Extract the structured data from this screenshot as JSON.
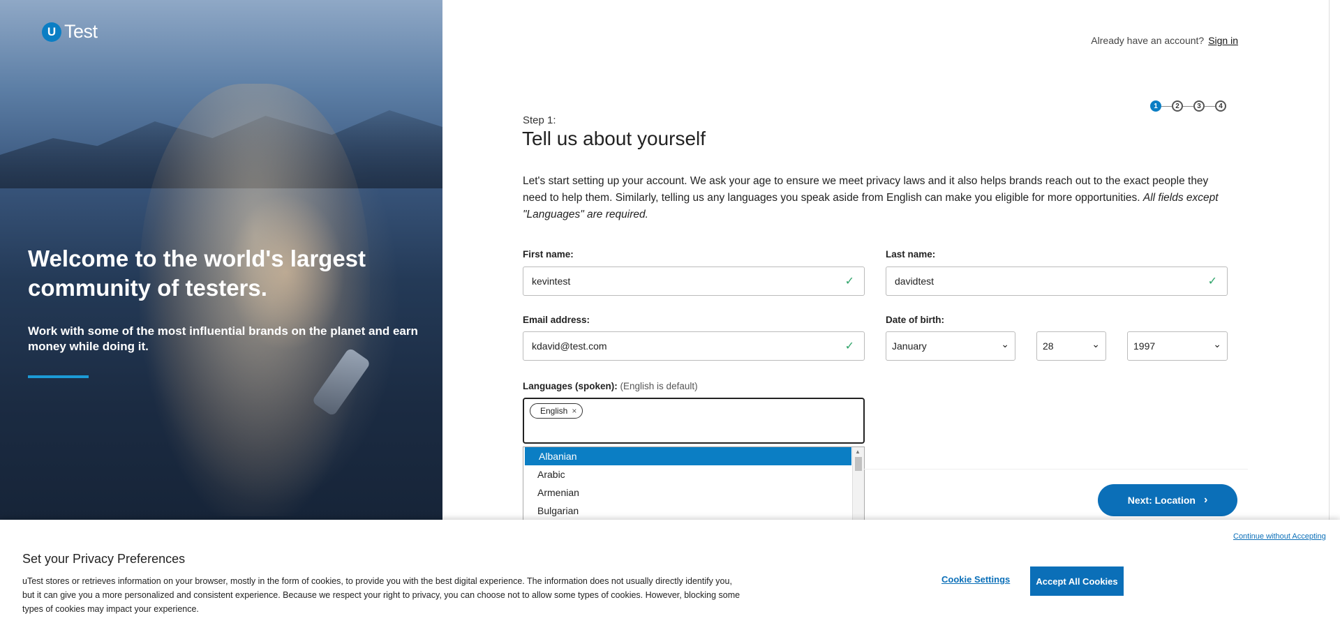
{
  "brand": {
    "logo_mark": "U",
    "logo_text": "Test",
    "accent": "#0b7ec4",
    "accent_dark": "#0b6fb8",
    "valid_color": "#2fa46a"
  },
  "hero": {
    "title": "Welcome to the world's largest community of testers.",
    "subtitle": "Work with some of the most influential brands on the planet and earn money while doing it."
  },
  "header": {
    "account_prompt": "Already have an account?",
    "signin_label": "Sign in"
  },
  "stepper": {
    "steps": [
      "1",
      "2",
      "3",
      "4"
    ],
    "current": 1
  },
  "form": {
    "step_label": "Step 1:",
    "title": "Tell us about yourself",
    "intro_text": "Let's start setting up your account. We ask your age to ensure we meet privacy laws and it also helps brands reach out to the exact people they need to help them. Similarly, telling us any languages you speak aside from English can make you eligible for more opportunities.",
    "intro_italic": "All fields except \"Languages\" are required.",
    "first_name": {
      "label": "First name:",
      "value": "kevintest"
    },
    "last_name": {
      "label": "Last name:",
      "value": "davidtest"
    },
    "email": {
      "label": "Email address:",
      "value": "kdavid@test.com"
    },
    "dob": {
      "label": "Date of birth:",
      "month": "January",
      "day": "28",
      "year": "1997"
    },
    "languages": {
      "label": "Languages (spoken):",
      "hint": "(English is default)",
      "selected": [
        "English"
      ],
      "options": [
        "Albanian",
        "Arabic",
        "Armenian",
        "Bulgarian"
      ],
      "highlighted": "Albanian"
    },
    "next_label": "Next: Location"
  },
  "icons": {
    "valid": "check-icon",
    "remove": "close-icon",
    "dropdown": "chevron-down-icon",
    "next": "chevron-right-icon"
  },
  "cookie_banner": {
    "title": "Set your Privacy Preferences",
    "text": "uTest stores or retrieves information on your browser, mostly in the form of cookies, to provide you with the best digital experience. The information does not usually directly identify you, but it can give you a more personalized and consistent experience. Because we respect your right to privacy, you can choose not to allow some types of cookies. However, blocking some types of cookies may impact your experience.",
    "continue_label": "Continue without Accepting",
    "settings_label": "Cookie Settings",
    "accept_label": "Accept All Cookies"
  }
}
